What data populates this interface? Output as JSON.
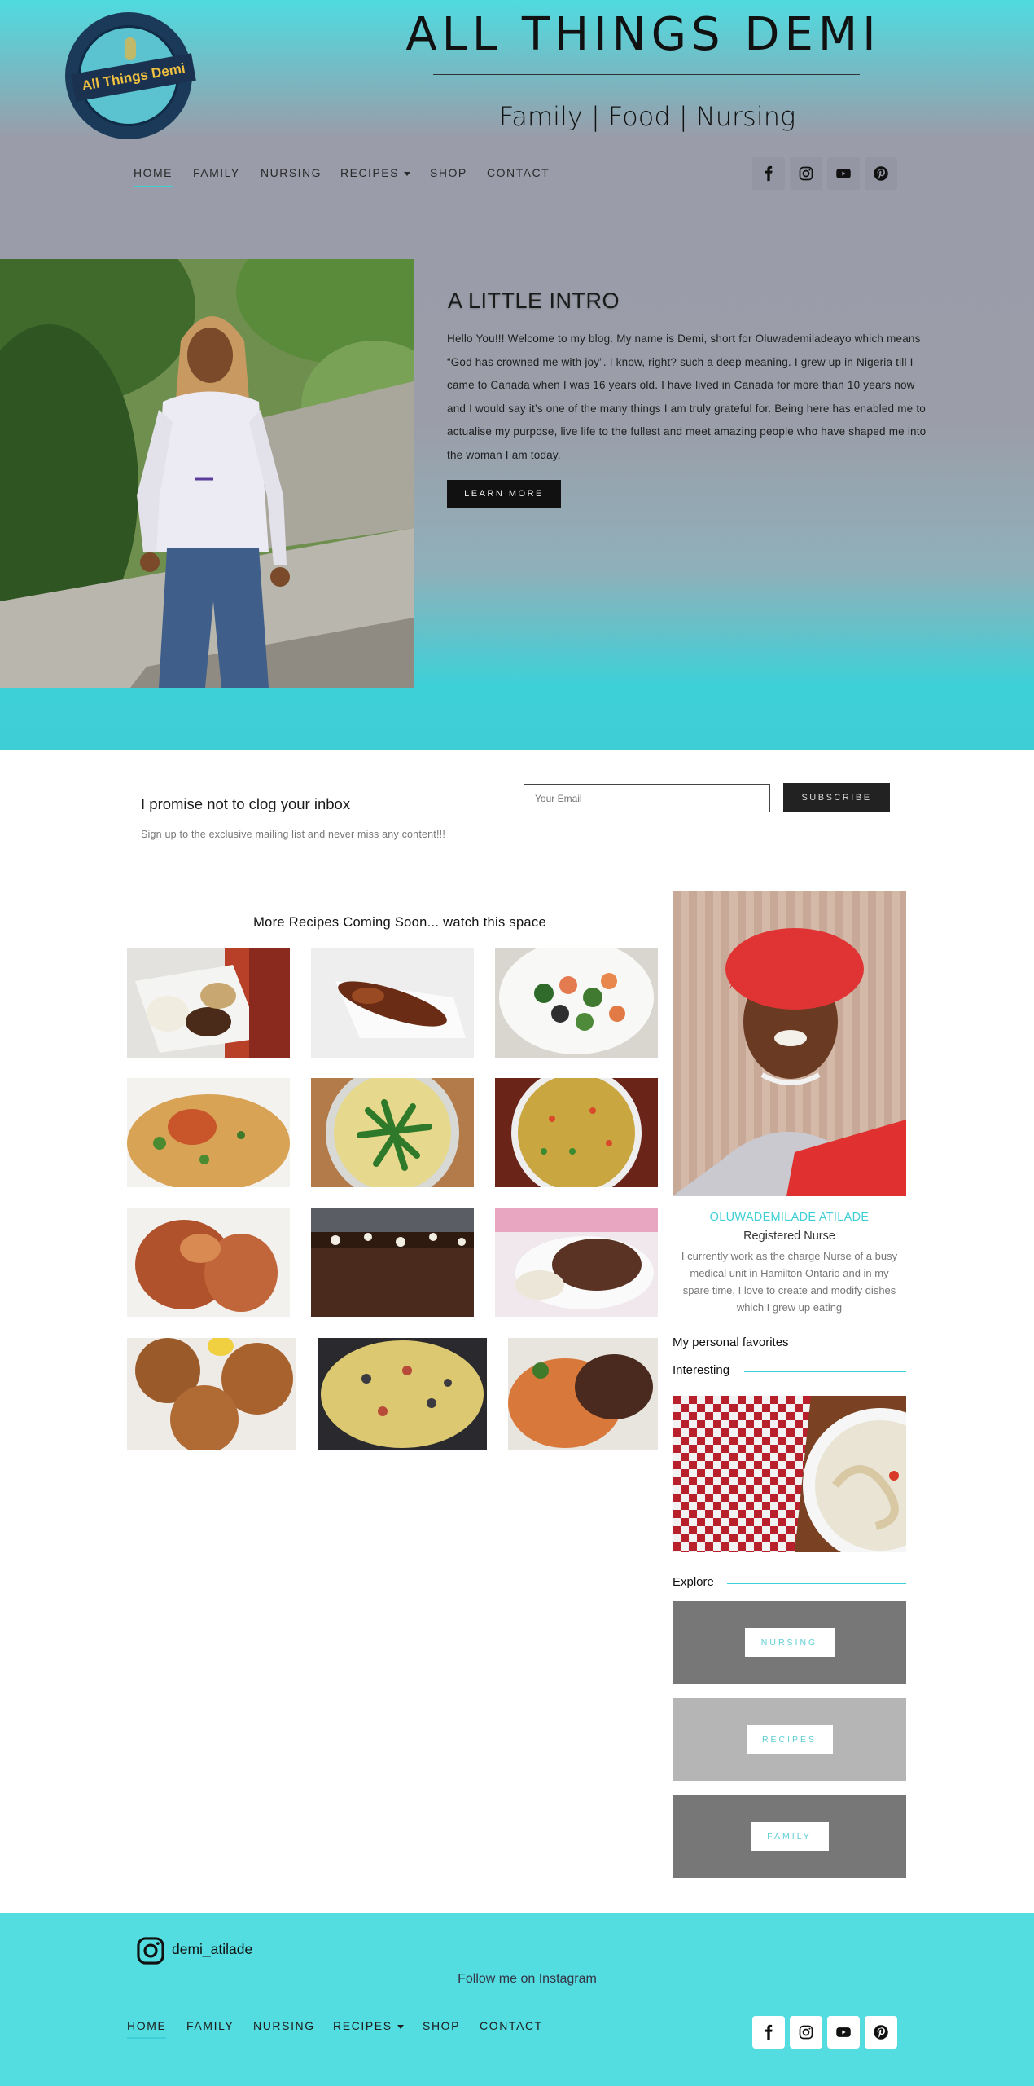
{
  "header": {
    "logo_text": "All Things Demi",
    "site_title": "ALL THINGS DEMI",
    "tagline": "Family | Food | Nursing"
  },
  "nav": {
    "items": [
      {
        "label": "HOME",
        "active": true
      },
      {
        "label": "FAMILY"
      },
      {
        "label": "NURSING"
      },
      {
        "label": "RECIPES",
        "has_dropdown": true
      },
      {
        "label": "SHOP"
      },
      {
        "label": "CONTACT"
      }
    ]
  },
  "social_icons": [
    "facebook-icon",
    "instagram-icon",
    "youtube-icon",
    "pinterest-icon"
  ],
  "intro": {
    "title": "A LITTLE INTRO",
    "body": "Hello You!!! Welcome to my blog. My name is Demi, short for Oluwademiladeayo which means “God has crowned me with joy”. I know, right? such a deep meaning. I grew up in Nigeria till I came to Canada when I was 16 years old. I have lived in Canada for more than 10 years now and I would say it’s one of the many things I am truly grateful for. Being here has enabled me to actualise my purpose, live life to the fullest and meet amazing people who have shaped me into the woman I am today.",
    "button_label": "LEARN MORE"
  },
  "newsletter": {
    "title": "I promise not to clog your inbox",
    "subtitle": "Sign up to the exclusive mailing list and never miss any content!!!",
    "email_placeholder": "Your Email",
    "button_label": "SUBSCRIBE"
  },
  "recipes": {
    "heading": "More Recipes Coming Soon... watch this space"
  },
  "profile": {
    "name": "OLUWADEMILADE ATILADE",
    "role": "Registered Nurse",
    "bio": "I currently work as the charge Nurse of a busy medical unit in Hamilton Ontario and in my spare time, I love to create and modify dishes which I grew up eating"
  },
  "sidebar": {
    "favorites_heading": "My personal favorites",
    "interesting_heading": "Interesting",
    "explore_heading": "Explore",
    "explore_buttons": [
      "NURSING",
      "RECIPES",
      "FAMILY"
    ]
  },
  "footer": {
    "instagram_handle": "demi_atilade",
    "follow_text": "Follow me on Instagram",
    "nav": [
      {
        "label": "HOME",
        "active": true
      },
      {
        "label": "FAMILY"
      },
      {
        "label": "NURSING"
      },
      {
        "label": "RECIPES",
        "has_dropdown": true
      },
      {
        "label": "SHOP"
      },
      {
        "label": "CONTACT"
      }
    ]
  },
  "colors": {
    "accent": "#3fcfd6",
    "footer_bg": "#53dde0",
    "button_dark": "#111111"
  }
}
